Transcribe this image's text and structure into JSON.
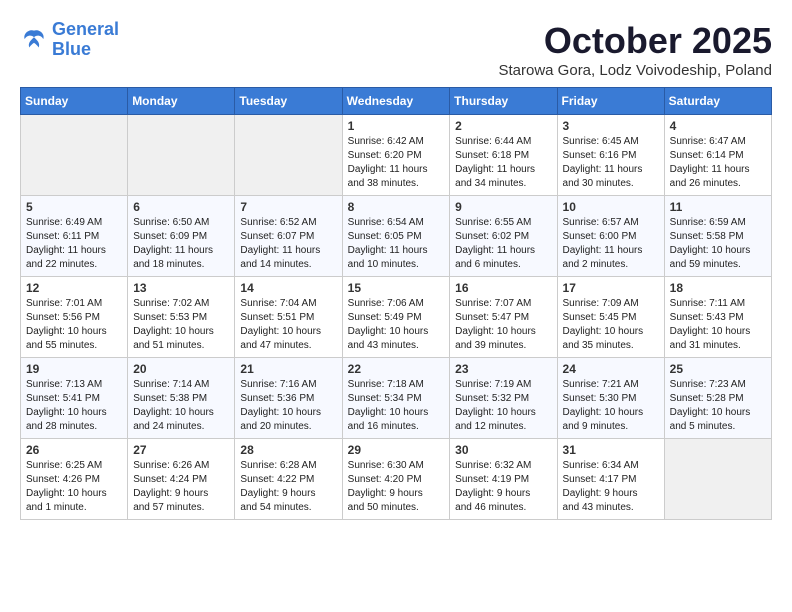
{
  "header": {
    "logo_line1": "General",
    "logo_line2": "Blue",
    "month": "October 2025",
    "location": "Starowa Gora, Lodz Voivodeship, Poland"
  },
  "weekdays": [
    "Sunday",
    "Monday",
    "Tuesday",
    "Wednesday",
    "Thursday",
    "Friday",
    "Saturday"
  ],
  "weeks": [
    [
      {
        "day": "",
        "info": ""
      },
      {
        "day": "",
        "info": ""
      },
      {
        "day": "",
        "info": ""
      },
      {
        "day": "1",
        "info": "Sunrise: 6:42 AM\nSunset: 6:20 PM\nDaylight: 11 hours\nand 38 minutes."
      },
      {
        "day": "2",
        "info": "Sunrise: 6:44 AM\nSunset: 6:18 PM\nDaylight: 11 hours\nand 34 minutes."
      },
      {
        "day": "3",
        "info": "Sunrise: 6:45 AM\nSunset: 6:16 PM\nDaylight: 11 hours\nand 30 minutes."
      },
      {
        "day": "4",
        "info": "Sunrise: 6:47 AM\nSunset: 6:14 PM\nDaylight: 11 hours\nand 26 minutes."
      }
    ],
    [
      {
        "day": "5",
        "info": "Sunrise: 6:49 AM\nSunset: 6:11 PM\nDaylight: 11 hours\nand 22 minutes."
      },
      {
        "day": "6",
        "info": "Sunrise: 6:50 AM\nSunset: 6:09 PM\nDaylight: 11 hours\nand 18 minutes."
      },
      {
        "day": "7",
        "info": "Sunrise: 6:52 AM\nSunset: 6:07 PM\nDaylight: 11 hours\nand 14 minutes."
      },
      {
        "day": "8",
        "info": "Sunrise: 6:54 AM\nSunset: 6:05 PM\nDaylight: 11 hours\nand 10 minutes."
      },
      {
        "day": "9",
        "info": "Sunrise: 6:55 AM\nSunset: 6:02 PM\nDaylight: 11 hours\nand 6 minutes."
      },
      {
        "day": "10",
        "info": "Sunrise: 6:57 AM\nSunset: 6:00 PM\nDaylight: 11 hours\nand 2 minutes."
      },
      {
        "day": "11",
        "info": "Sunrise: 6:59 AM\nSunset: 5:58 PM\nDaylight: 10 hours\nand 59 minutes."
      }
    ],
    [
      {
        "day": "12",
        "info": "Sunrise: 7:01 AM\nSunset: 5:56 PM\nDaylight: 10 hours\nand 55 minutes."
      },
      {
        "day": "13",
        "info": "Sunrise: 7:02 AM\nSunset: 5:53 PM\nDaylight: 10 hours\nand 51 minutes."
      },
      {
        "day": "14",
        "info": "Sunrise: 7:04 AM\nSunset: 5:51 PM\nDaylight: 10 hours\nand 47 minutes."
      },
      {
        "day": "15",
        "info": "Sunrise: 7:06 AM\nSunset: 5:49 PM\nDaylight: 10 hours\nand 43 minutes."
      },
      {
        "day": "16",
        "info": "Sunrise: 7:07 AM\nSunset: 5:47 PM\nDaylight: 10 hours\nand 39 minutes."
      },
      {
        "day": "17",
        "info": "Sunrise: 7:09 AM\nSunset: 5:45 PM\nDaylight: 10 hours\nand 35 minutes."
      },
      {
        "day": "18",
        "info": "Sunrise: 7:11 AM\nSunset: 5:43 PM\nDaylight: 10 hours\nand 31 minutes."
      }
    ],
    [
      {
        "day": "19",
        "info": "Sunrise: 7:13 AM\nSunset: 5:41 PM\nDaylight: 10 hours\nand 28 minutes."
      },
      {
        "day": "20",
        "info": "Sunrise: 7:14 AM\nSunset: 5:38 PM\nDaylight: 10 hours\nand 24 minutes."
      },
      {
        "day": "21",
        "info": "Sunrise: 7:16 AM\nSunset: 5:36 PM\nDaylight: 10 hours\nand 20 minutes."
      },
      {
        "day": "22",
        "info": "Sunrise: 7:18 AM\nSunset: 5:34 PM\nDaylight: 10 hours\nand 16 minutes."
      },
      {
        "day": "23",
        "info": "Sunrise: 7:19 AM\nSunset: 5:32 PM\nDaylight: 10 hours\nand 12 minutes."
      },
      {
        "day": "24",
        "info": "Sunrise: 7:21 AM\nSunset: 5:30 PM\nDaylight: 10 hours\nand 9 minutes."
      },
      {
        "day": "25",
        "info": "Sunrise: 7:23 AM\nSunset: 5:28 PM\nDaylight: 10 hours\nand 5 minutes."
      }
    ],
    [
      {
        "day": "26",
        "info": "Sunrise: 6:25 AM\nSunset: 4:26 PM\nDaylight: 10 hours\nand 1 minute."
      },
      {
        "day": "27",
        "info": "Sunrise: 6:26 AM\nSunset: 4:24 PM\nDaylight: 9 hours\nand 57 minutes."
      },
      {
        "day": "28",
        "info": "Sunrise: 6:28 AM\nSunset: 4:22 PM\nDaylight: 9 hours\nand 54 minutes."
      },
      {
        "day": "29",
        "info": "Sunrise: 6:30 AM\nSunset: 4:20 PM\nDaylight: 9 hours\nand 50 minutes."
      },
      {
        "day": "30",
        "info": "Sunrise: 6:32 AM\nSunset: 4:19 PM\nDaylight: 9 hours\nand 46 minutes."
      },
      {
        "day": "31",
        "info": "Sunrise: 6:34 AM\nSunset: 4:17 PM\nDaylight: 9 hours\nand 43 minutes."
      },
      {
        "day": "",
        "info": ""
      }
    ]
  ]
}
